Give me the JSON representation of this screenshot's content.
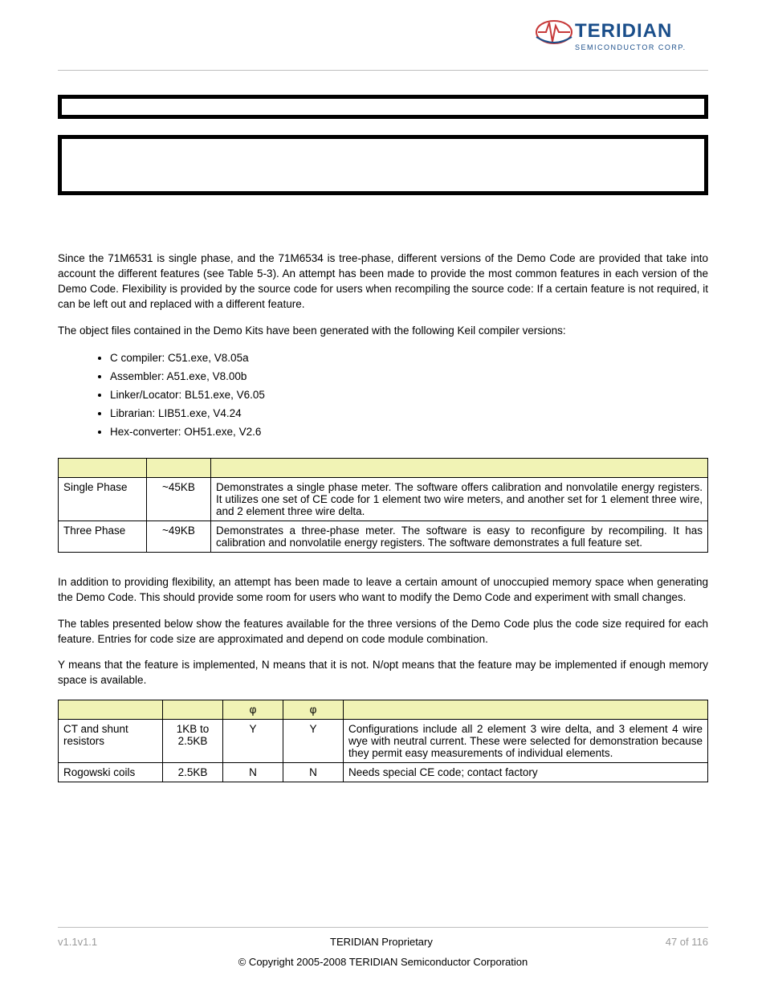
{
  "logo": {
    "brand": "TERIDIAN",
    "sub": "SEMICONDUCTOR CORP."
  },
  "para1": "Since the 71M6531 is single phase, and the 71M6534 is tree-phase, different versions of the Demo Code are provided that take into account the different features (see Table 5-3). An attempt has been made to provide the most common features in each version of the Demo Code. Flexibility is provided by the source code for users when recompiling the source code: If a certain feature is not required, it can be left out and replaced with a different feature.",
  "para2": "The object files contained in the Demo Kits have been generated with the following Keil compiler versions:",
  "bullets": [
    "C compiler: C51.exe, V8.05a",
    "Assembler: A51.exe, V8.00b",
    "Linker/Locator: BL51.exe, V6.05",
    "Librarian: LIB51.exe, V4.24",
    "Hex-converter: OH51.exe, V2.6"
  ],
  "table1": {
    "headers": [
      "",
      "",
      ""
    ],
    "rows": [
      {
        "c1": "Single Phase",
        "c2": "~45KB",
        "c3": "Demonstrates a single phase meter. The software offers calibration and nonvolatile energy registers. It utilizes one set of CE code for 1 element two wire meters, and another set for 1 element three wire, and 2 element three wire delta."
      },
      {
        "c1": "Three Phase",
        "c2": "~49KB",
        "c3": "Demonstrates a three-phase meter. The software is easy to reconfigure by recompiling. It has calibration and nonvolatile energy registers. The software demonstrates a full feature set."
      }
    ]
  },
  "para3": "In addition to providing flexibility, an attempt has been made to leave a certain amount of unoccupied memory space when generating the Demo Code. This should provide some room for users who want to modify the Demo Code and experiment with small changes.",
  "para4": "The tables presented below show the features available for the three versions of the Demo Code plus the code size required for each feature. Entries for code size are approximated and depend on code module combination.",
  "para5": "Y means that the feature is implemented, N means that it is not. N/opt means that the feature may be implemented if enough memory space is available.",
  "table2": {
    "phi": "φ",
    "rows": [
      {
        "c1": "CT and shunt resistors",
        "c2": "1KB to 2.5KB",
        "c3": "Y",
        "c4": "Y",
        "c5": "Configurations include all 2 element 3 wire delta, and 3 element 4 wire wye with neutral current.  These were selected for demonstration because they permit easy measurements of individual elements."
      },
      {
        "c1": "Rogowski coils",
        "c2": "2.5KB",
        "c3": "N",
        "c4": "N",
        "c5": "Needs special CE code; contact factory"
      }
    ]
  },
  "footer": {
    "left": "v1.1v1.1",
    "center": "TERIDIAN Proprietary",
    "right": "47 of 116",
    "copyright": "© Copyright 2005-2008 TERIDIAN Semiconductor Corporation"
  }
}
